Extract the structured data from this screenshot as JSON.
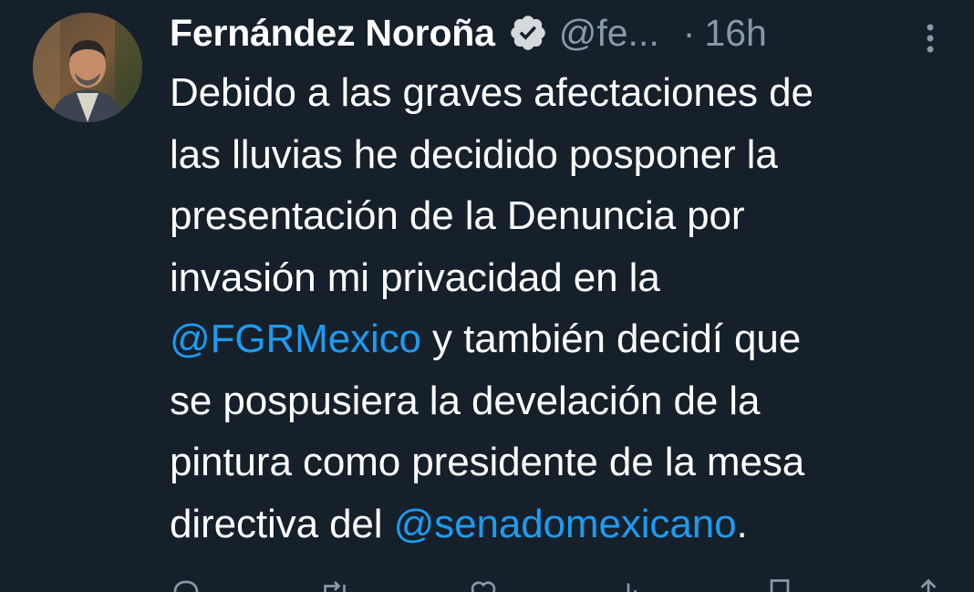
{
  "author": {
    "name": "Fernández Noroña",
    "handle": "@fe...",
    "separator": "·",
    "time": "16h"
  },
  "icons": {
    "verified": "verified-badge-icon",
    "more": "more-options-icon",
    "reply": "reply-icon",
    "retweet": "retweet-icon",
    "like": "like-icon",
    "views": "views-icon",
    "bookmark": "bookmark-icon",
    "share": "share-icon"
  },
  "colors": {
    "background": "#15202b",
    "text": "#ffffff",
    "secondary": "#8899a6",
    "link": "#1d9bf0"
  },
  "tweet": {
    "line1": "Debido a las graves afectaciones de",
    "line2": "las lluvias he decidido posponer la",
    "line3": "presentación de la Denuncia por",
    "line4": "invasión mi privacidad en la",
    "mention1": "@FGRMexico",
    "line5_rest": " y también decidí que",
    "line6": "se pospusiera la develación de la",
    "line7": "pintura como presidente de la mesa",
    "line8_start": "directiva del ",
    "mention2": "@senadomexicano",
    "line8_end": "."
  }
}
